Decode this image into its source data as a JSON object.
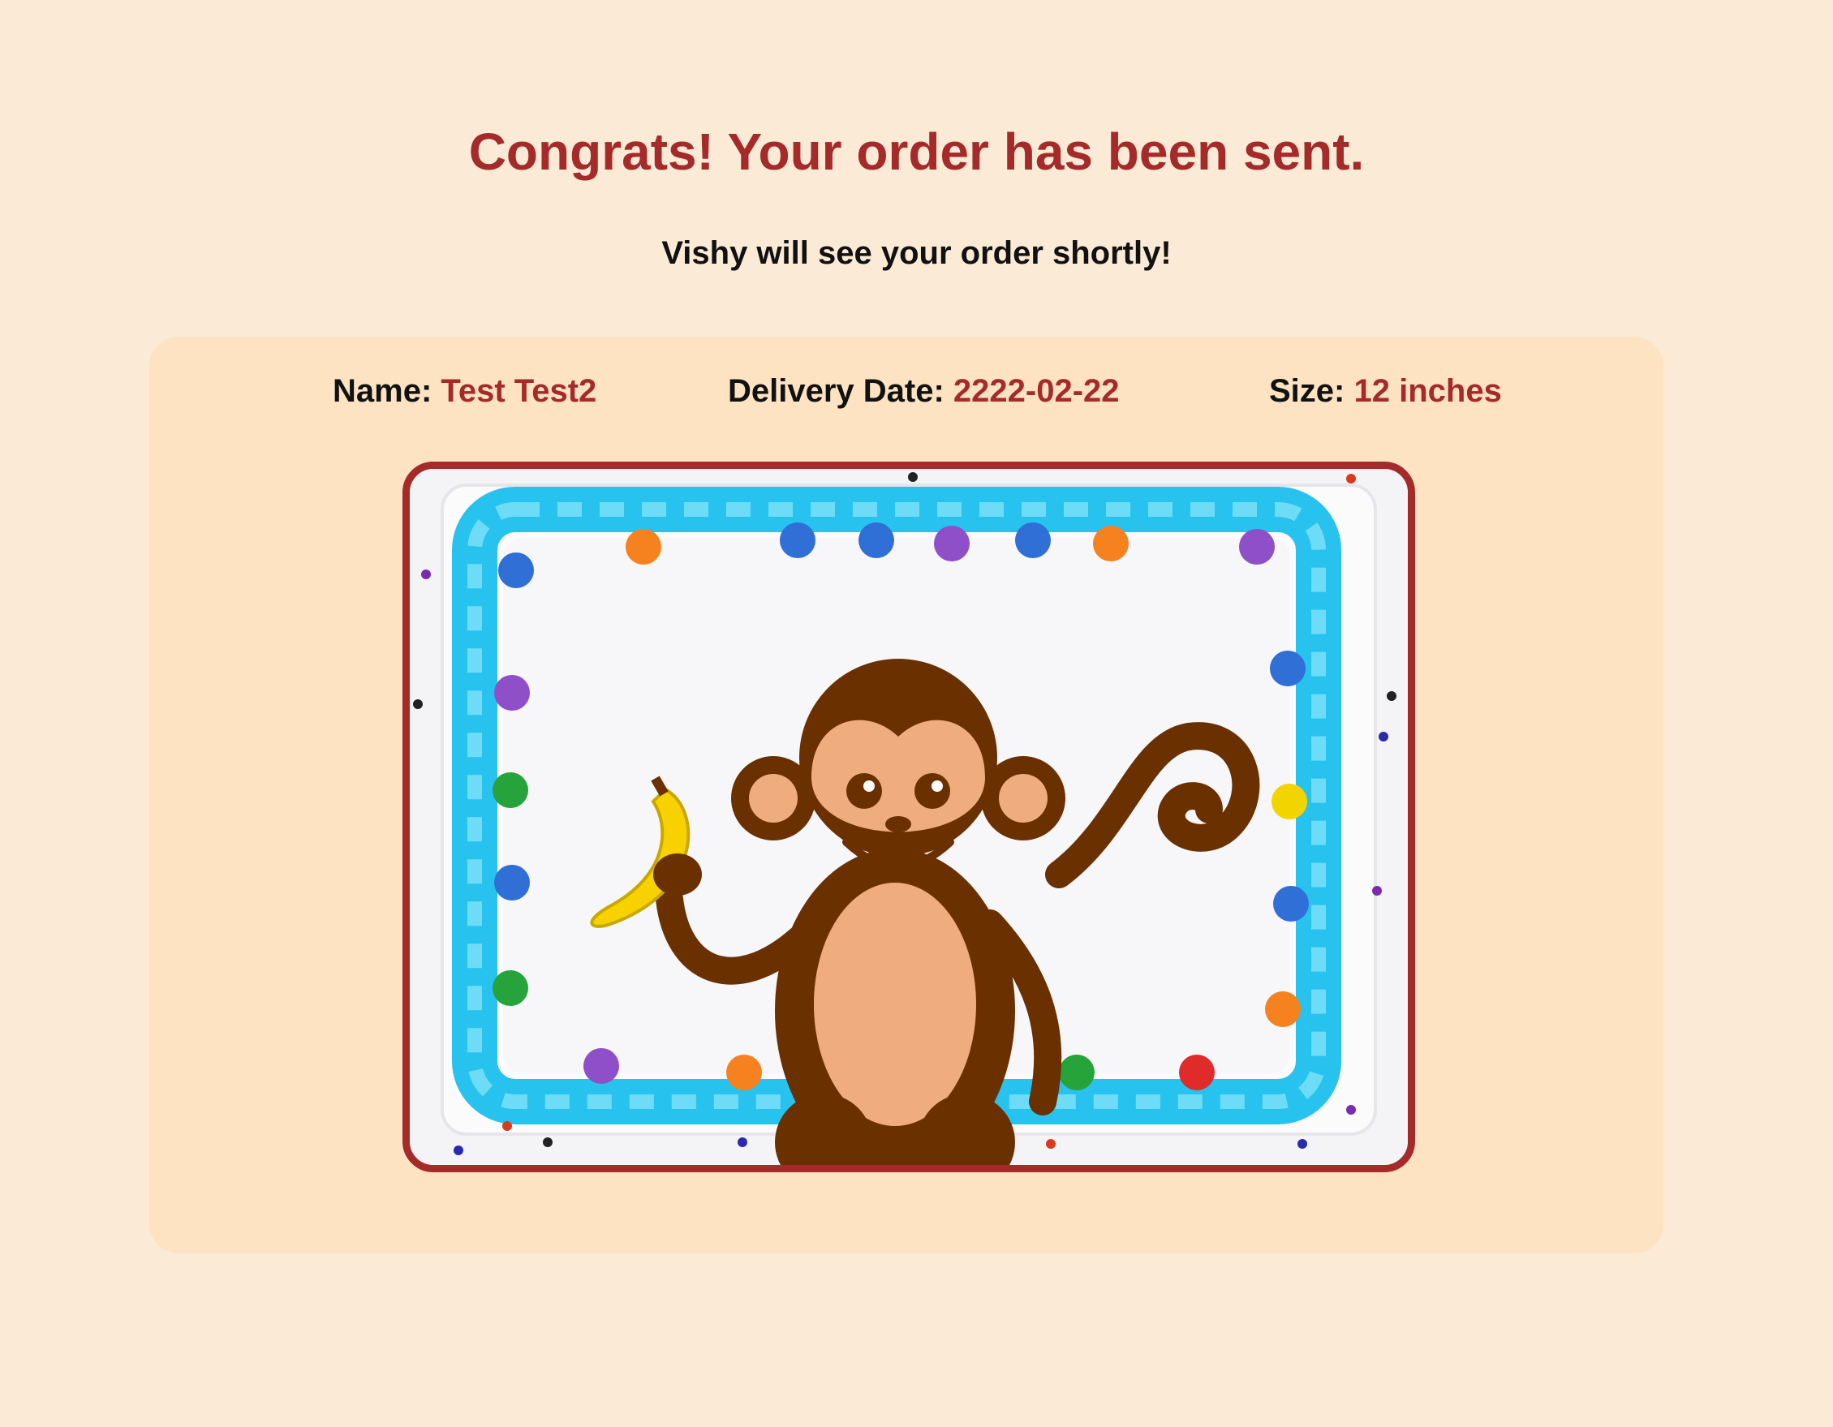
{
  "confirmation": {
    "title": "Congrats! Your order has been sent.",
    "subtitle": "Vishy will see your order shortly!"
  },
  "order": {
    "name_label": "Name:",
    "name_value": "Test Test2",
    "date_label": "Delivery Date:",
    "date_value": "2222-02-22",
    "size_label": "Size:",
    "size_value": "12 inches"
  },
  "image": {
    "subject": "monkey-cake-icon"
  },
  "colors": {
    "background": "#faead6",
    "card": "#fde3c2",
    "accent": "#a52a2a",
    "frosting": "#27c3ee"
  }
}
